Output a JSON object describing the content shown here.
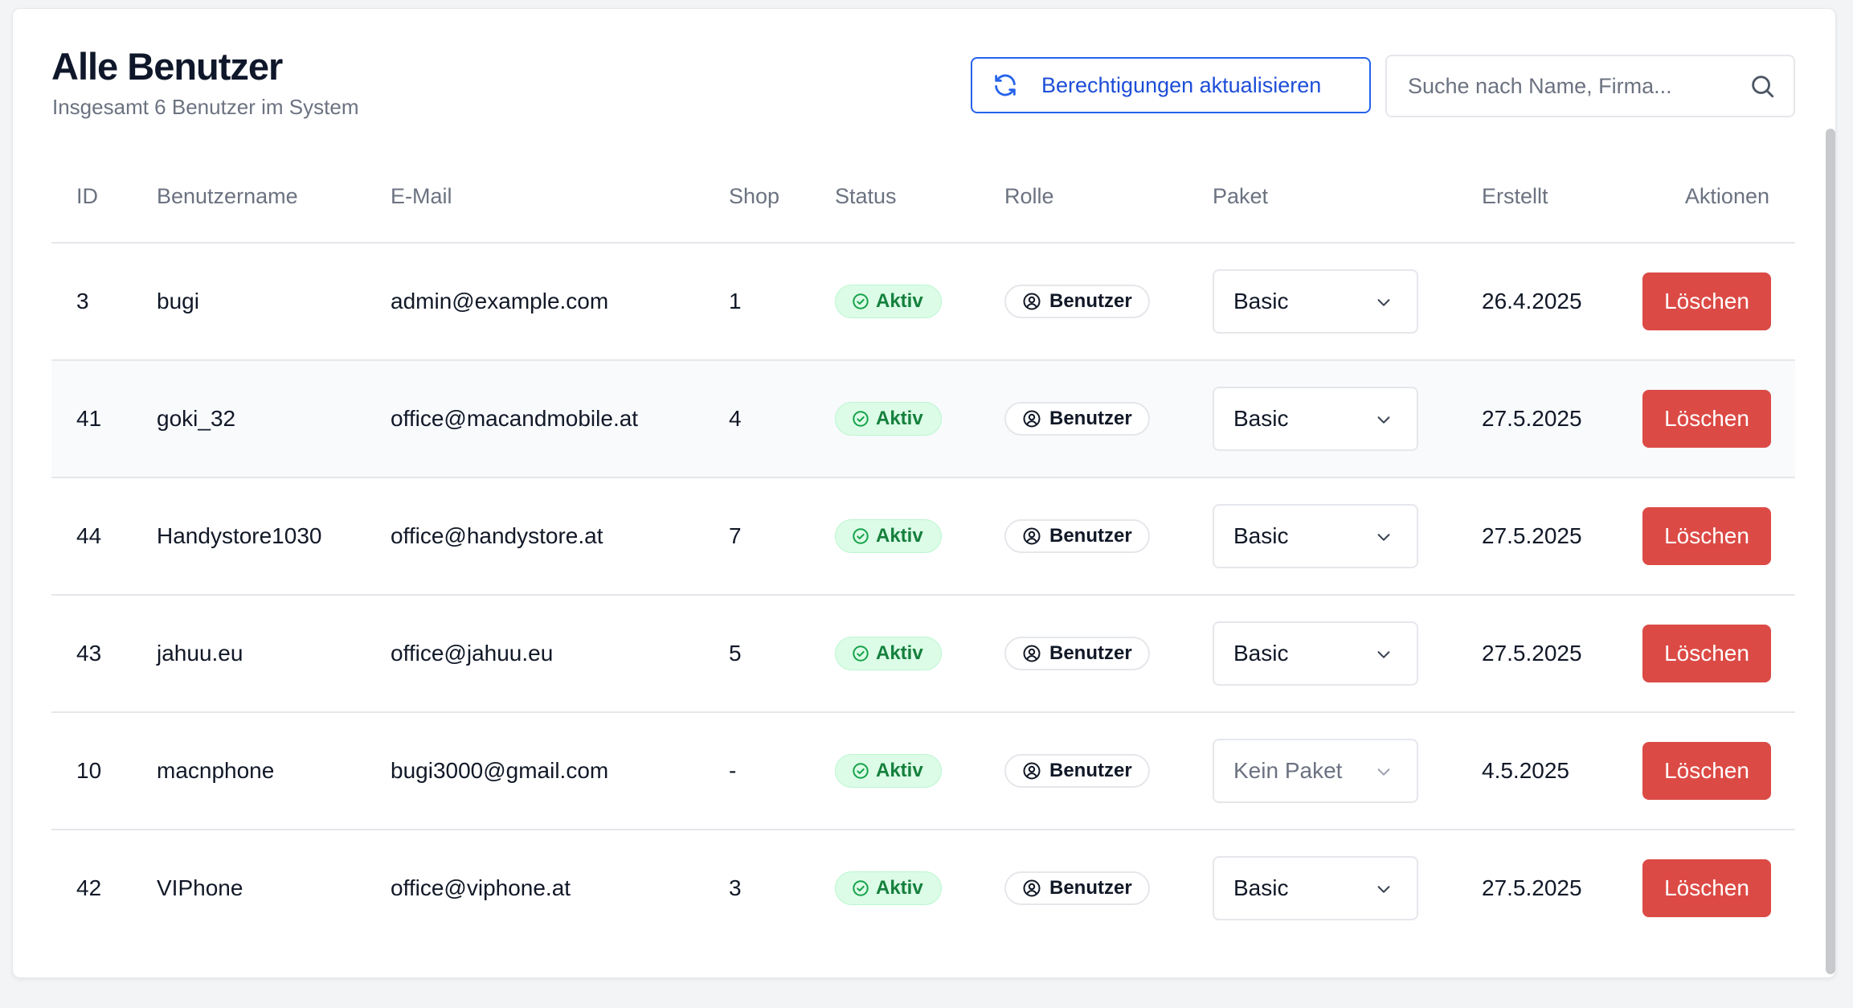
{
  "header": {
    "title": "Alle Benutzer",
    "subtitle": "Insgesamt 6 Benutzer im System",
    "refresh_label": "Berechtigungen aktualisieren",
    "search_placeholder": "Suche nach Name, Firma..."
  },
  "table": {
    "columns": [
      "ID",
      "Benutzername",
      "E-Mail",
      "Shop",
      "Status",
      "Rolle",
      "Paket",
      "Erstellt",
      "Aktionen"
    ],
    "rows": [
      {
        "id": "3",
        "username": "bugi",
        "email": "admin@example.com",
        "shop": "1",
        "status": "Aktiv",
        "role": "Benutzer",
        "paket": "Basic",
        "created": "26.4.2025",
        "action": "Löschen"
      },
      {
        "id": "41",
        "username": "goki_32",
        "email": "office@macandmobile.at",
        "shop": "4",
        "status": "Aktiv",
        "role": "Benutzer",
        "paket": "Basic",
        "created": "27.5.2025",
        "action": "Löschen"
      },
      {
        "id": "44",
        "username": "Handystore1030",
        "email": "office@handystore.at",
        "shop": "7",
        "status": "Aktiv",
        "role": "Benutzer",
        "paket": "Basic",
        "created": "27.5.2025",
        "action": "Löschen"
      },
      {
        "id": "43",
        "username": "jahuu.eu",
        "email": "office@jahuu.eu",
        "shop": "5",
        "status": "Aktiv",
        "role": "Benutzer",
        "paket": "Basic",
        "created": "27.5.2025",
        "action": "Löschen"
      },
      {
        "id": "10",
        "username": "macnphone",
        "email": "bugi3000@gmail.com",
        "shop": "-",
        "status": "Aktiv",
        "role": "Benutzer",
        "paket": "Kein Paket",
        "created": "4.5.2025",
        "action": "Löschen"
      },
      {
        "id": "42",
        "username": "VIPhone",
        "email": "office@viphone.at",
        "shop": "3",
        "status": "Aktiv",
        "role": "Benutzer",
        "paket": "Basic",
        "created": "27.5.2025",
        "action": "Löschen"
      }
    ]
  },
  "colors": {
    "accent_blue": "#2563eb",
    "status_green": "#15803d",
    "status_green_bg": "#dcfce7",
    "delete_red": "#dc4a45"
  },
  "icons": {
    "refresh": "refresh-icon",
    "search": "search-icon",
    "status": "check-circle-icon",
    "role": "user-circle-icon",
    "select": "chevron-down-icon"
  }
}
